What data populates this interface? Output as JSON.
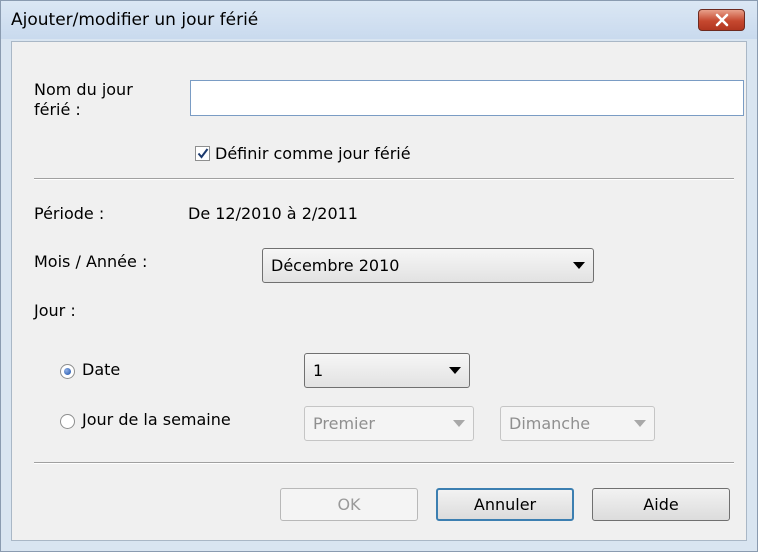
{
  "window": {
    "title": "Ajouter/modifier un jour férié",
    "close_icon": "close-icon"
  },
  "form": {
    "name_label_line1": "Nom du jour",
    "name_label_line2": "férié :",
    "name_value": "",
    "holiday_checkbox_label": "Définir comme jour férié",
    "holiday_checked": true,
    "period_label": "Période :",
    "period_value": "De 12/2010 à 2/2011",
    "month_year_label": "Mois / Année :",
    "month_year_value": "Décembre 2010",
    "day_label": "Jour :",
    "date_radio_label": "Date",
    "date_selected": true,
    "date_value": "1",
    "weekday_radio_label": "Jour de la semaine",
    "weekday_ordinal_value": "Premier",
    "weekday_day_value": "Dimanche"
  },
  "buttons": {
    "ok": "OK",
    "cancel": "Annuler",
    "help": "Aide"
  }
}
